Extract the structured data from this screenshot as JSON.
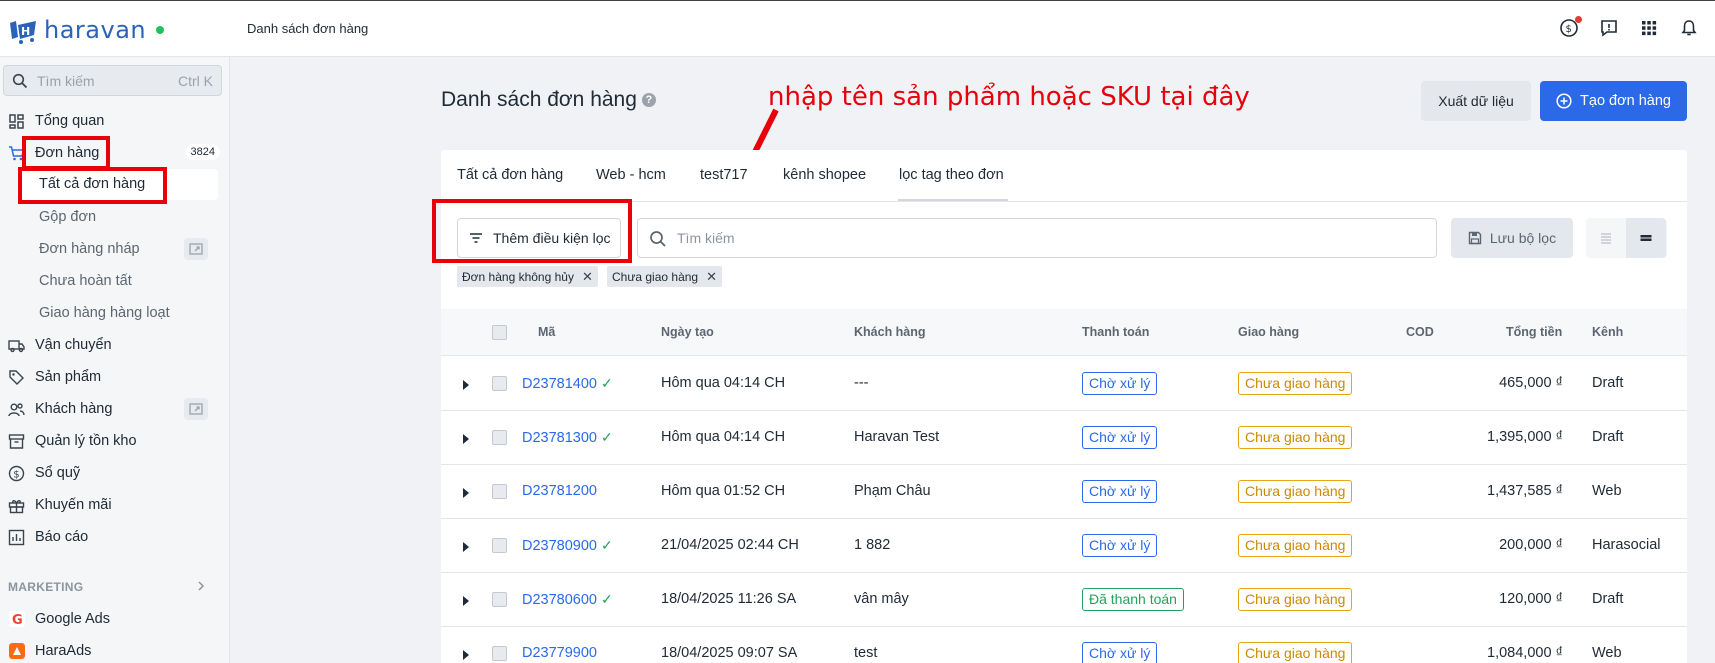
{
  "app": {
    "logo_text": "haravan",
    "breadcrumb": "Danh sách đơn hàng"
  },
  "sidebar": {
    "search_placeholder": "Tìm kiếm",
    "search_shortcut": "Ctrl K",
    "items": [
      {
        "label": "Tổng quan",
        "icon": "dashboard-icon"
      },
      {
        "label": "Đơn hàng",
        "icon": "cart-icon",
        "badge": "3824"
      },
      {
        "label": "Tất cả đơn hàng",
        "active": true
      },
      {
        "label": "Gộp đơn"
      },
      {
        "label": "Đơn hàng nháp"
      },
      {
        "label": "Chưa hoàn tất"
      },
      {
        "label": "Giao hàng hàng loạt"
      },
      {
        "label": "Vận chuyển",
        "icon": "truck-icon"
      },
      {
        "label": "Sản phẩm",
        "icon": "tag-icon"
      },
      {
        "label": "Khách hàng",
        "icon": "users-icon"
      },
      {
        "label": "Quản lý tồn kho",
        "icon": "archive-icon"
      },
      {
        "label": "Sổ quỹ",
        "icon": "dollar-icon"
      },
      {
        "label": "Khuyến mãi",
        "icon": "gift-icon"
      },
      {
        "label": "Báo cáo",
        "icon": "chart-icon"
      }
    ],
    "section_marketing": "MARKETING",
    "marketing_items": [
      {
        "label": "Google Ads",
        "icon": "google-icon"
      },
      {
        "label": "HaraAds",
        "icon": "haraads-icon"
      }
    ]
  },
  "page": {
    "title": "Danh sách đơn hàng",
    "annotation": "nhập tên sản phẩm hoặc SKU tại đây",
    "export_label": "Xuất dữ liệu",
    "create_label": "Tạo đơn hàng",
    "tabs": [
      "Tất cả đơn hàng",
      "Web - hcm",
      "test717",
      "kênh shopee",
      "lọc tag theo đơn"
    ],
    "filter_label": "Thêm điều kiện lọc",
    "search_placeholder": "Tìm kiếm",
    "save_filter_label": "Lưu bộ lọc",
    "chips": [
      "Đơn hàng không hủy",
      "Chưa giao hàng"
    ]
  },
  "table": {
    "columns": [
      "Mã",
      "Ngày tạo",
      "Khách hàng",
      "Thanh toán",
      "Giao hàng",
      "COD",
      "Tổng tiền",
      "Kênh"
    ],
    "rows": [
      {
        "id": "D23781400",
        "verified": true,
        "date": "Hôm qua 04:14 CH",
        "customer": "---",
        "payment": "Chờ xử lý",
        "payment_status": "pending",
        "shipping": "Chưa giao hàng",
        "total": "465,000 ₫",
        "channel": "Draft"
      },
      {
        "id": "D23781300",
        "verified": true,
        "date": "Hôm qua 04:14 CH",
        "customer": "Haravan Test",
        "payment": "Chờ xử lý",
        "payment_status": "pending",
        "shipping": "Chưa giao hàng",
        "total": "1,395,000 ₫",
        "channel": "Draft"
      },
      {
        "id": "D23781200",
        "verified": false,
        "date": "Hôm qua 01:52 CH",
        "customer": "Phạm Châu",
        "payment": "Chờ xử lý",
        "payment_status": "pending",
        "shipping": "Chưa giao hàng",
        "total": "1,437,585 ₫",
        "channel": "Web"
      },
      {
        "id": "D23780900",
        "verified": true,
        "date": "21/04/2025 02:44 CH",
        "customer": "1 882",
        "payment": "Chờ xử lý",
        "payment_status": "pending",
        "shipping": "Chưa giao hàng",
        "total": "200,000 ₫",
        "channel": "Harasocial"
      },
      {
        "id": "D23780600",
        "verified": true,
        "date": "18/04/2025 11:26 SA",
        "customer": "vân mây",
        "payment": "Đã thanh toán",
        "payment_status": "paid",
        "shipping": "Chưa giao hàng",
        "total": "120,000 ₫",
        "channel": "Draft"
      },
      {
        "id": "D23779900",
        "verified": false,
        "date": "18/04/2025 09:07 SA",
        "customer": "test",
        "payment": "Chờ xử lý",
        "payment_status": "pending",
        "shipping": "Chưa giao hàng",
        "total": "1,084,000 ₫",
        "channel": "Web"
      }
    ]
  },
  "colors": {
    "accent": "#2c69e8",
    "annotation": "#e8000b",
    "paid": "#21a35b",
    "unshipped": "#e8a417"
  }
}
